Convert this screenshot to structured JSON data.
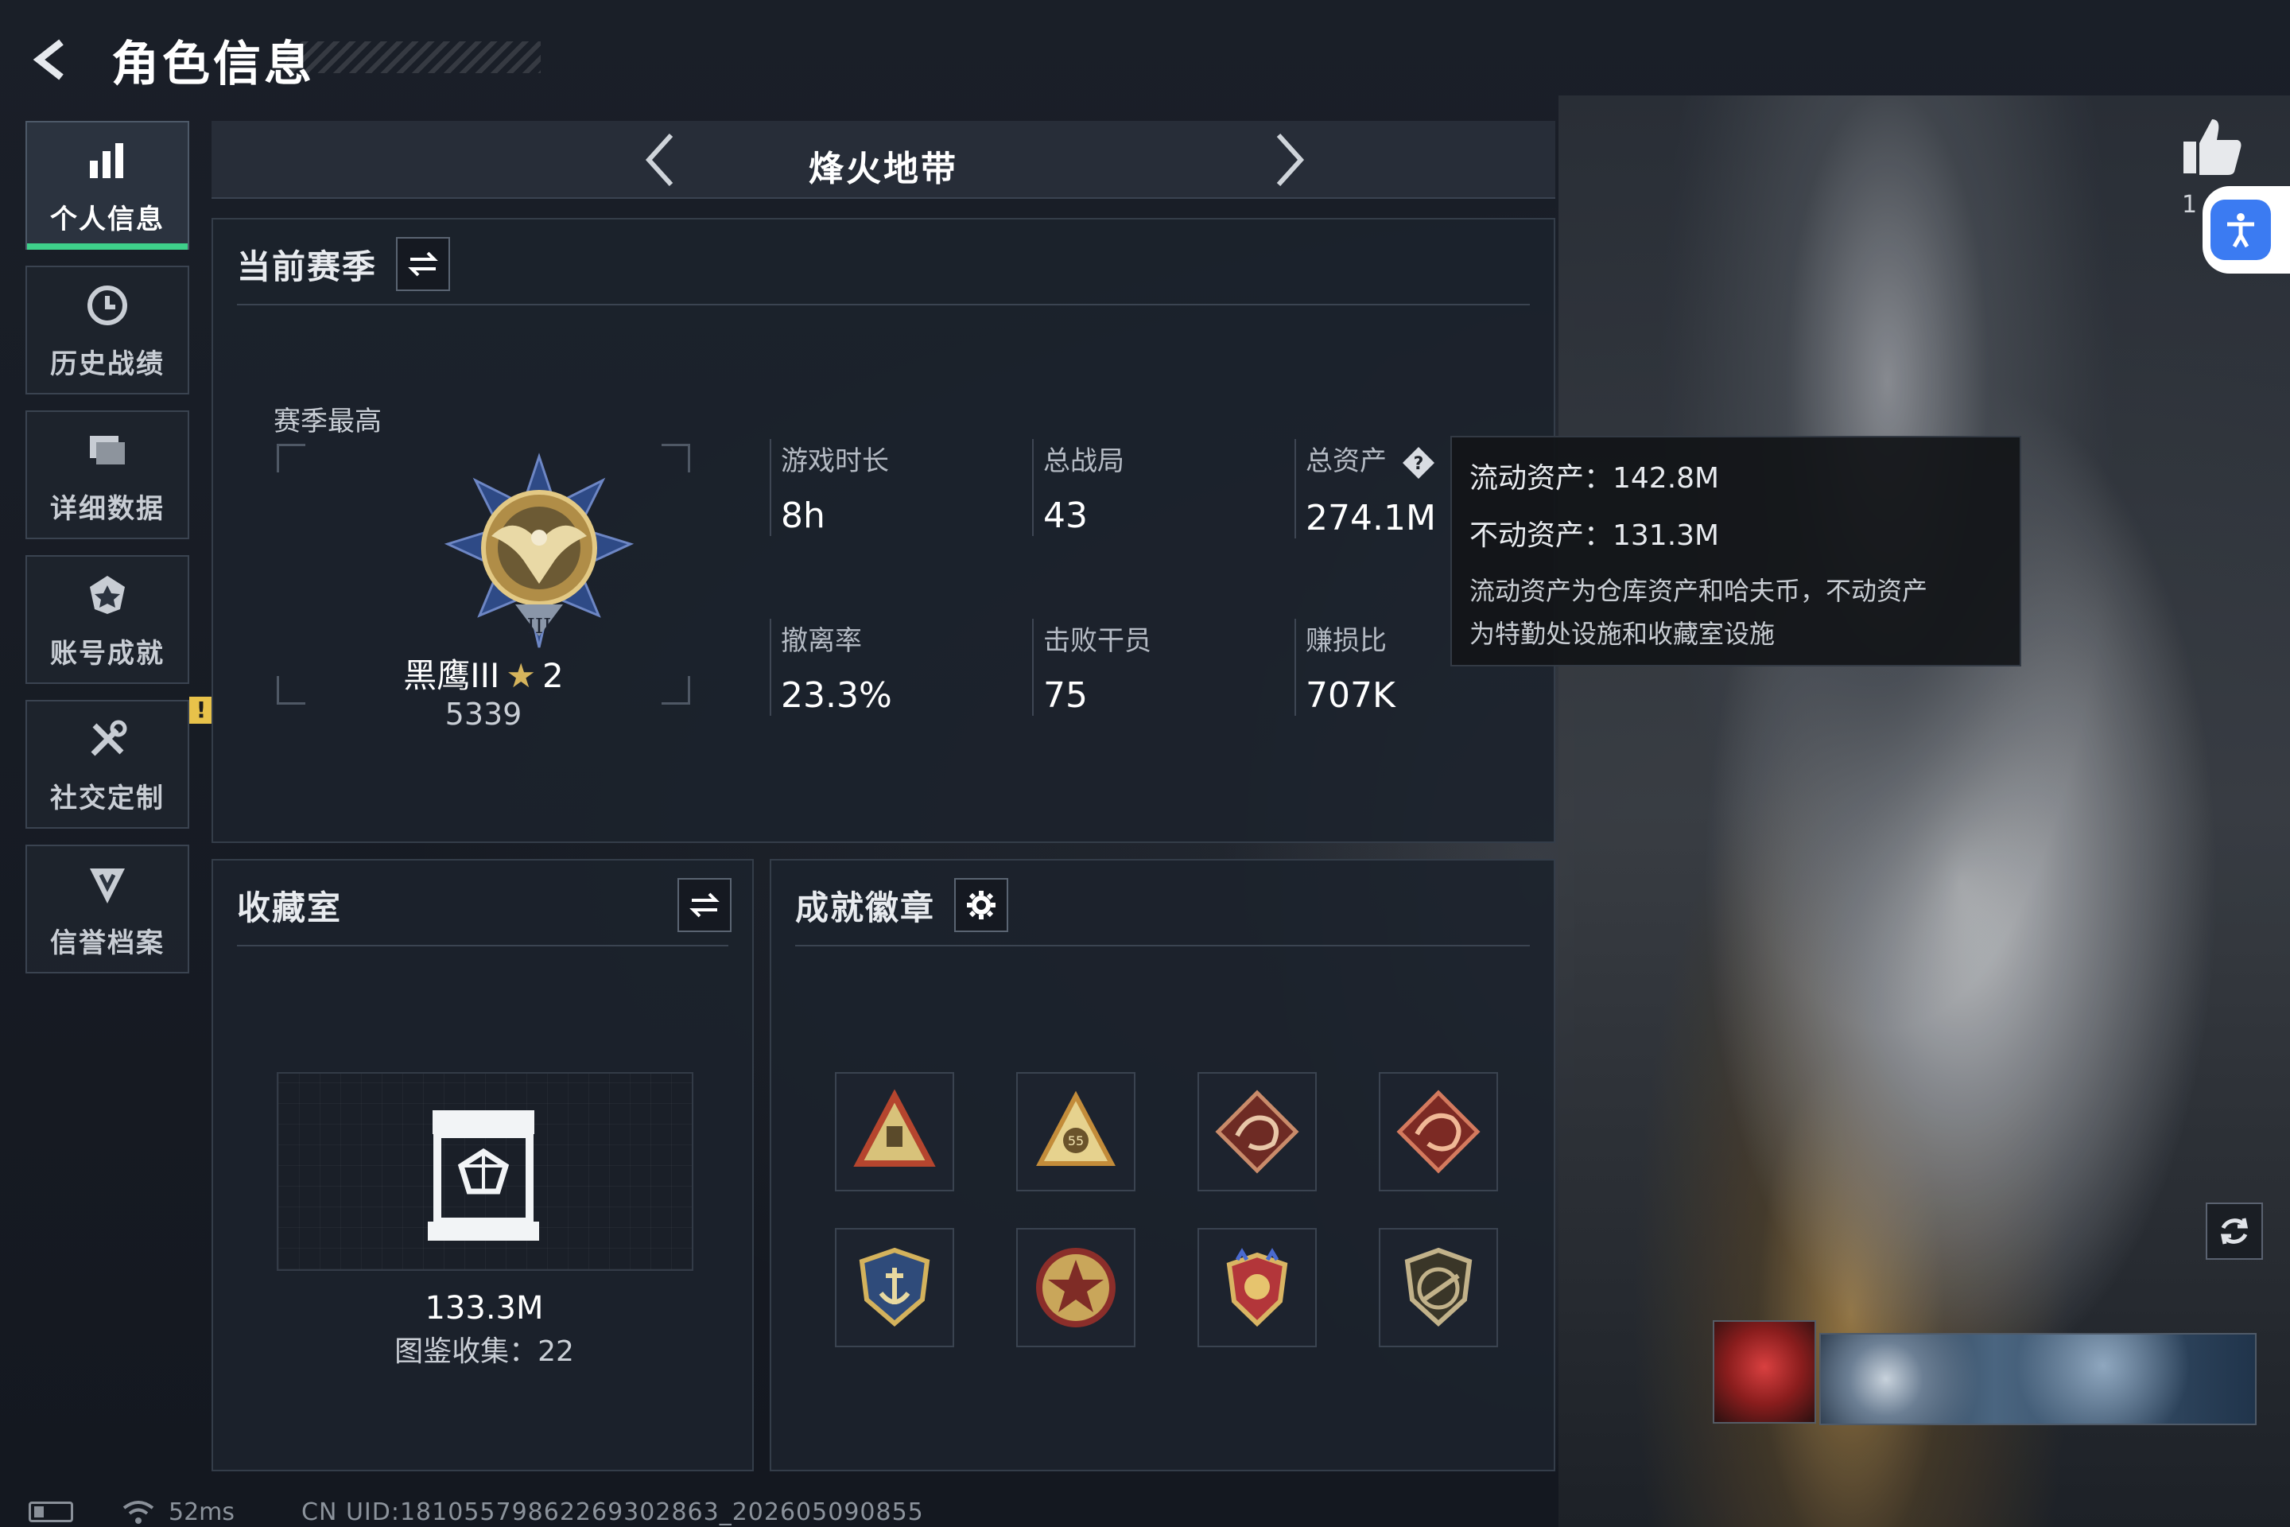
{
  "header": {
    "title": "角色信息"
  },
  "sidebar": {
    "items": [
      {
        "label": "个人信息",
        "active": true,
        "icon": "bar-chart-icon"
      },
      {
        "label": "历史战绩",
        "active": false,
        "icon": "history-clock-icon"
      },
      {
        "label": "详细数据",
        "active": false,
        "icon": "folder-data-icon"
      },
      {
        "label": "账号成就",
        "active": false,
        "icon": "achievement-icon"
      },
      {
        "label": "社交定制",
        "active": false,
        "icon": "tools-icon",
        "badge": "!"
      },
      {
        "label": "信誉档案",
        "active": false,
        "icon": "reputation-shield-icon"
      }
    ]
  },
  "mode": {
    "label": "烽火地带"
  },
  "season": {
    "title": "当前赛季",
    "best_label": "赛季最高",
    "rank_name": "黑鹰III",
    "rank_star": "★",
    "rank_stars": "2",
    "rank_score": "5339",
    "stats": [
      {
        "label": "游戏时长",
        "value": "8h"
      },
      {
        "label": "总战局",
        "value": "43"
      },
      {
        "label": "总资产",
        "value": "274.1M"
      },
      {
        "label": "撤离率",
        "value": "23.3%"
      },
      {
        "label": "击败干员",
        "value": "75"
      },
      {
        "label": "赚损比",
        "value": "707K"
      }
    ]
  },
  "tooltip": {
    "liquid": "流动资产：142.8M",
    "fixed": "不动资产：131.3M",
    "desc_line1": "流动资产为仓库资产和哈夫币，不动资产",
    "desc_line2": "为特勤处设施和收藏室设施"
  },
  "collection": {
    "title": "收藏室",
    "value": "133.3M",
    "count": "图鉴收集：22"
  },
  "badges": {
    "title": "成就徽章",
    "items": [
      "triangle-badge-icon",
      "triangle-55-badge-icon",
      "dragon-badge-icon",
      "dragon-red-badge-icon",
      "anchor-shield-badge-icon",
      "star-medal-badge-icon",
      "crest-badge-icon",
      "rifle-shield-badge-icon"
    ]
  },
  "right": {
    "like_count": "1"
  },
  "status": {
    "ping": "52ms",
    "uid": "CN UID:18105579862269302863_202605090855"
  },
  "colors": {
    "accent_green": "#3ed08a",
    "warn_yellow": "#e8c24a",
    "access_blue": "#3b7bf2",
    "gold": "#d6b45c"
  }
}
